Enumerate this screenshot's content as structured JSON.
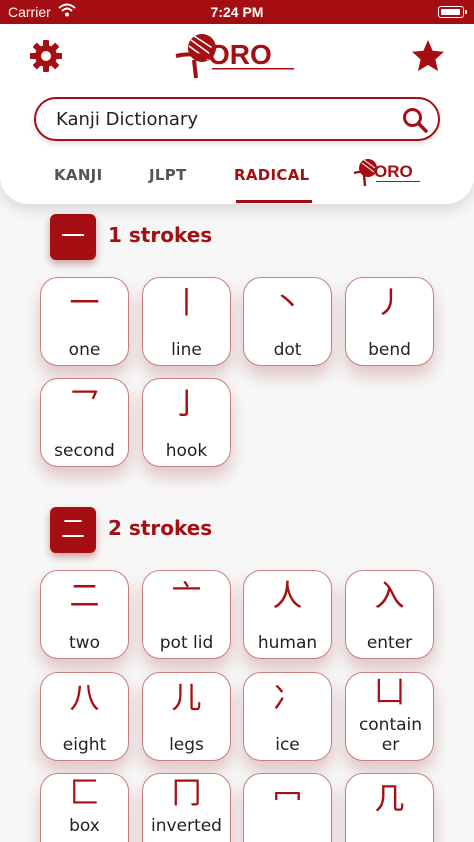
{
  "status": {
    "carrier": "Carrier",
    "time": "7:24 PM"
  },
  "search": {
    "value": "Kanji Dictionary"
  },
  "tabs": [
    "KANJI",
    "JLPT",
    "RADICAL"
  ],
  "accent": "#a50e12",
  "sections": [
    {
      "icon": "一",
      "title": "1 strokes",
      "items": [
        {
          "glyph": "一",
          "label": "one"
        },
        {
          "glyph": "丨",
          "label": "line"
        },
        {
          "glyph": "丶",
          "label": "dot"
        },
        {
          "glyph": "丿",
          "label": "bend"
        },
        {
          "glyph": "乛",
          "label": "second"
        },
        {
          "glyph": "亅",
          "label": "hook"
        }
      ]
    },
    {
      "icon": "二",
      "title": "2 strokes",
      "items": [
        {
          "glyph": "二",
          "label": "two"
        },
        {
          "glyph": "亠",
          "label": "pot lid"
        },
        {
          "glyph": "人",
          "label": "human"
        },
        {
          "glyph": "入",
          "label": "enter"
        },
        {
          "glyph": "八",
          "label": "eight"
        },
        {
          "glyph": "儿",
          "label": "legs"
        },
        {
          "glyph": "冫",
          "label": "ice"
        },
        {
          "glyph": "凵",
          "label": "contain er"
        },
        {
          "glyph": "匚",
          "label": "box"
        },
        {
          "glyph": "冂",
          "label": "inverted"
        },
        {
          "glyph": "冖",
          "label": ""
        },
        {
          "glyph": "几",
          "label": ""
        }
      ]
    }
  ]
}
